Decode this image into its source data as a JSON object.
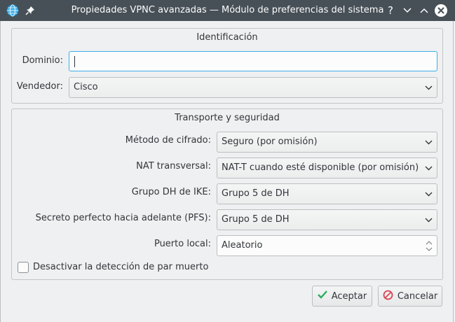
{
  "window": {
    "title": "Propiedades VPNC avanzadas — Módulo de preferencias del sistema",
    "icons": [
      "globe-icon",
      "pin-icon",
      "help-icon",
      "minimize-icon",
      "maximize-icon",
      "close-icon"
    ],
    "help_glyph": "?"
  },
  "identificacion": {
    "title": "Identificación",
    "dominio_label": "Dominio:",
    "dominio_value": "",
    "vendedor_label": "Vendedor:",
    "vendedor_value": "Cisco"
  },
  "transporte": {
    "title": "Transporte y seguridad",
    "cifrado_label": "Método de cifrado:",
    "cifrado_value": "Seguro (por omisión)",
    "nat_label": "NAT transversal:",
    "nat_value": "NAT-T cuando esté disponible (por omisión)",
    "dh_label": "Grupo DH de IKE:",
    "dh_value": "Grupo 5 de DH",
    "pfs_label": "Secreto perfecto hacia adelante (PFS):",
    "pfs_value": "Grupo 5 de DH",
    "puerto_label": "Puerto local:",
    "puerto_value": "Aleatorio",
    "dpd_label": "Desactivar la detección de par muerto",
    "dpd_checked": false
  },
  "buttons": {
    "accept_label": "Aceptar",
    "cancel_label": "Cancelar"
  },
  "colors": {
    "titlebar": "#475057",
    "focus": "#3daee9",
    "accept_icon": "#27ae60",
    "cancel_icon": "#da4453"
  }
}
